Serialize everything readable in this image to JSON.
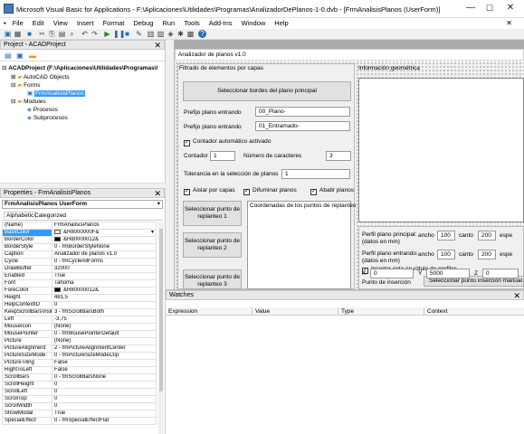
{
  "window": {
    "title": "Microsoft Visual Basic for Applications - F:\\Aplicaciones\\Utilidades\\Programas\\AnalizadorDePlanos-1-0.dvb - [FrmAnalisisPlanos (UserForm)]",
    "min": "—",
    "max": "☐",
    "close": "✕"
  },
  "menu": [
    "File",
    "Edit",
    "View",
    "Insert",
    "Format",
    "Debug",
    "Run",
    "Tools",
    "Add-Ins",
    "Window",
    "Help"
  ],
  "project": {
    "title": "Project - ACADProject",
    "root": "ACADProject (F:\\Aplicaciones\\Utilidades\\Programas\\/",
    "autocad": "AutoCAD Objects",
    "forms": "Forms",
    "form1": "FrmAnalisisPlanos",
    "modules": "Modules",
    "mod1": "Procesos",
    "mod2": "Subprocesos"
  },
  "properties": {
    "title": "Properties - FrmAnalisisPlanos",
    "object": "FrmAnalisisPlanos UserForm",
    "tabs": [
      "Alphabetic",
      "Categorized"
    ],
    "rows": [
      [
        "(Name)",
        "FrmAnalisisPlanos",
        ""
      ],
      [
        "BackColor",
        "&H8000000F&",
        "#f0f0f0"
      ],
      [
        "BorderColor",
        "&H80000012&",
        "#000000"
      ],
      [
        "BorderStyle",
        "0 - fmBorderStyleNone",
        ""
      ],
      [
        "Caption",
        "Analizador de planos v1.0",
        ""
      ],
      [
        "Cycle",
        "0 - fmCycleAllForms",
        ""
      ],
      [
        "DrawBuffer",
        "32000",
        ""
      ],
      [
        "Enabled",
        "True",
        ""
      ],
      [
        "Font",
        "Tahoma",
        ""
      ],
      [
        "ForeColor",
        "&H80000012&",
        "#000000"
      ],
      [
        "Height",
        "481,5",
        ""
      ],
      [
        "HelpContextID",
        "0",
        ""
      ],
      [
        "KeepScrollBarsVisible",
        "3 - fmScrollBarsBoth",
        ""
      ],
      [
        "Left",
        "-3,75",
        ""
      ],
      [
        "MouseIcon",
        "(None)",
        ""
      ],
      [
        "MousePointer",
        "0 - fmMousePointerDefault",
        ""
      ],
      [
        "Picture",
        "(None)",
        ""
      ],
      [
        "PictureAlignment",
        "2 - fmPictureAlignmentCenter",
        ""
      ],
      [
        "PictureSizeMode",
        "0 - fmPictureSizeModeClip",
        ""
      ],
      [
        "PictureTiling",
        "False",
        ""
      ],
      [
        "RightToLeft",
        "False",
        ""
      ],
      [
        "ScrollBars",
        "0 - fmScrollBarsNone",
        ""
      ],
      [
        "ScrollHeight",
        "0",
        ""
      ],
      [
        "ScrollLeft",
        "0",
        ""
      ],
      [
        "ScrollTop",
        "0",
        ""
      ],
      [
        "ScrollWidth",
        "0",
        ""
      ],
      [
        "ShowModal",
        "True",
        ""
      ],
      [
        "SpecialEffect",
        "0 - fmSpecialEffectFlat",
        ""
      ]
    ]
  },
  "form": {
    "caption": "Analizador de planos v1.0",
    "frame_filter": "Filtrado de elementos por capas",
    "btn_select_border": "Seleccionar bordes del plano principal",
    "prefix_label": "Prefijo plano entrando",
    "prefix_value": "00_Plano-",
    "prefix2_label": "Prefijo plano entrando",
    "prefix2_value": "01_Entramado-",
    "auto_counter": "Contador automático activado",
    "counter_label": "Contador",
    "counter_value": "1",
    "chars_label": "Número de caracteres",
    "chars_value": "3",
    "tolerance_label": "Tolerancia en la selección de planos",
    "tolerance_value": "1",
    "chk_isolate": "Aislar por capas",
    "chk_blur": "Difuminar planos",
    "chk_abate": "Abatir planos",
    "btn_point1": "Seleccionar punto de replanteo 1",
    "btn_point2": "Seleccionar punto de replanteo 2",
    "btn_point3": "Seleccionar punto de replanteo 3",
    "coords_title": "Coordenadas de los puntos de replanteo",
    "info_title": "Información geométrica",
    "profile_main": "Perfil plano principal: (datos en mm)",
    "width_label": "ancho",
    "width_value": "100",
    "edge_label": "canto",
    "edge_value": "200",
    "thick_label": "espe",
    "profile_in": "Perfil plano entrando: (datos en mm)",
    "width2_value": "100",
    "edge2_value": "200",
    "chk_insert": "Insertar cota en rótulo de perfiles",
    "insert_point": "Punto de inserción",
    "btn_insert": "Seleccionar punto inserción manual",
    "x_label": "X",
    "x_value": "0",
    "y_label": "Y",
    "y_value": "5000",
    "z_label": "Z",
    "z_value": "0"
  },
  "watches": {
    "title": "Watches",
    "cols": [
      "Expression",
      "Value",
      "Type",
      "Context"
    ]
  }
}
